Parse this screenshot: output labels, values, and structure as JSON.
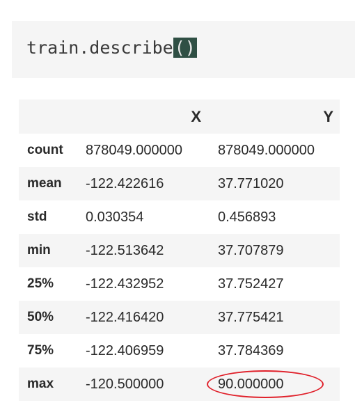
{
  "code_cell": {
    "code_prefix": "train.describe",
    "code_parens": "()"
  },
  "table": {
    "columns": [
      "",
      "X",
      "Y"
    ],
    "rows": [
      {
        "label": "count",
        "x": "878049.000000",
        "y": "878049.000000"
      },
      {
        "label": "mean",
        "x": "-122.422616",
        "y": "37.771020"
      },
      {
        "label": "std",
        "x": "0.030354",
        "y": "0.456893"
      },
      {
        "label": "min",
        "x": "-122.513642",
        "y": "37.707879"
      },
      {
        "label": "25%",
        "x": "-122.432952",
        "y": "37.752427"
      },
      {
        "label": "50%",
        "x": "-122.416420",
        "y": "37.775421"
      },
      {
        "label": "75%",
        "x": "-122.406959",
        "y": "37.784369"
      },
      {
        "label": "max",
        "x": "-120.500000",
        "y": "90.000000"
      }
    ]
  },
  "annotation": {
    "highlight_color": "#e0202a",
    "highlighted_cell": "max-y"
  }
}
